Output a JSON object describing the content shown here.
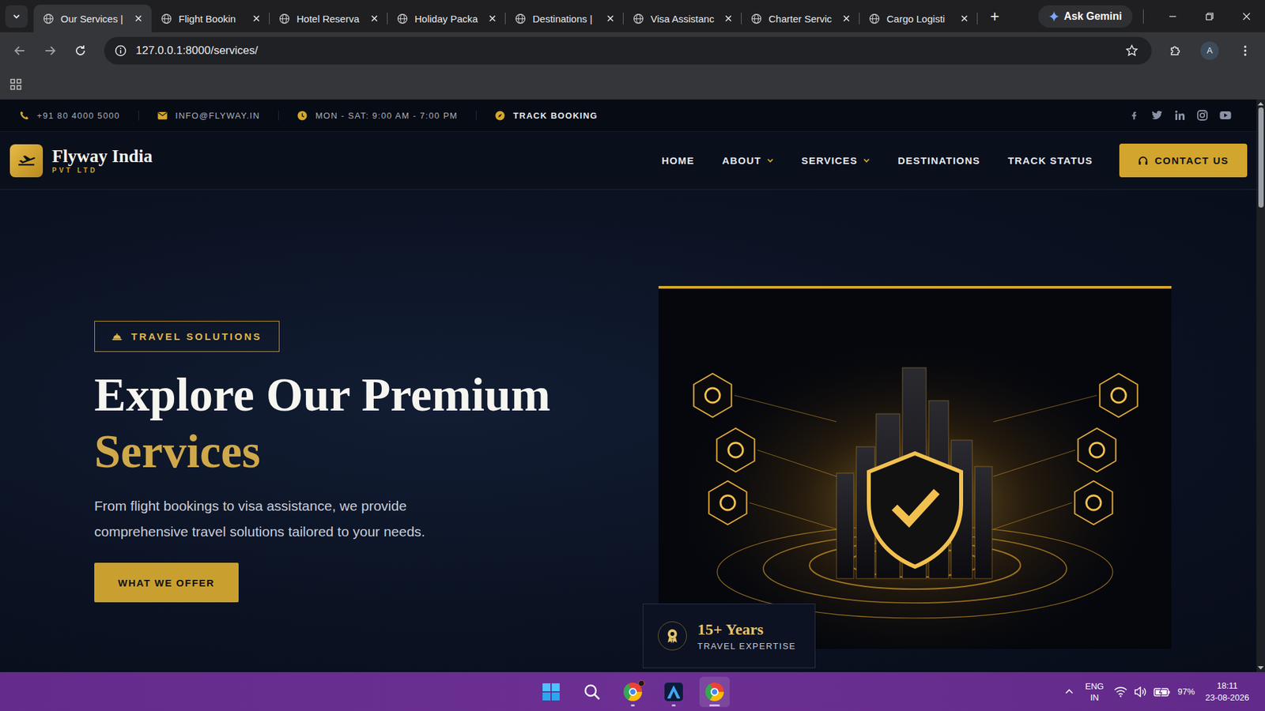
{
  "browser": {
    "tabs": [
      {
        "label": "Our Services |",
        "selected": true
      },
      {
        "label": "Flight Bookin",
        "selected": false
      },
      {
        "label": "Hotel Reserva",
        "selected": false
      },
      {
        "label": "Holiday Packa",
        "selected": false
      },
      {
        "label": "Destinations |",
        "selected": false
      },
      {
        "label": "Visa Assistanc",
        "selected": false
      },
      {
        "label": "Charter Servic",
        "selected": false
      },
      {
        "label": "Cargo Logisti",
        "selected": false
      }
    ],
    "new_tab": "+",
    "gemini": "Ask Gemini",
    "url": "127.0.0.1:8000/services/",
    "profile": "A"
  },
  "topbar": {
    "items": [
      {
        "kind": "phone",
        "label": "+91 80 4000 5000"
      },
      {
        "kind": "mail",
        "label": "INFO@FLYWAY.IN"
      },
      {
        "kind": "clock",
        "label": "MON - SAT: 9:00 AM - 7:00 PM"
      },
      {
        "kind": "track",
        "label": "TRACK BOOKING"
      }
    ],
    "socials": [
      {
        "kind": "facebook"
      },
      {
        "kind": "twitter"
      },
      {
        "kind": "linkedin"
      },
      {
        "kind": "instagram"
      },
      {
        "kind": "youtube"
      }
    ]
  },
  "navbar": {
    "brand": "Flyway India",
    "tagline": "PVT LTD",
    "items": [
      {
        "label": "HOME",
        "dropdown": false
      },
      {
        "label": "ABOUT",
        "dropdown": true
      },
      {
        "label": "SERVICES",
        "dropdown": true
      },
      {
        "label": "DESTINATIONS",
        "dropdown": false
      },
      {
        "label": "TRACK STATUS",
        "dropdown": false
      }
    ],
    "cta": "CONTACT US"
  },
  "hero": {
    "badge": "TRAVEL SOLUTIONS",
    "title": "Explore Our Premium",
    "highlight": "Services",
    "text": "From flight bookings to visa assistance, we provide comprehensive travel solutions tailored to your needs.",
    "button": "WHAT WE OFFER",
    "stat": {
      "value": "15+ Years",
      "label": "TRAVEL EXPERTISE"
    }
  },
  "scrollbar": {
    "level": 0.18
  },
  "taskbar": {
    "apps": [
      {
        "kind": "start",
        "running": false,
        "active": false,
        "notification": false
      },
      {
        "kind": "search",
        "running": false,
        "active": false,
        "notification": false
      },
      {
        "kind": "chrome",
        "running": true,
        "active": false,
        "notification": true
      },
      {
        "kind": "editor",
        "running": true,
        "active": false,
        "notification": false
      },
      {
        "kind": "chrome",
        "running": true,
        "active": true,
        "notification": false
      }
    ],
    "language": "ENG",
    "region": "IN",
    "battery": "97%",
    "time": "18:11",
    "date": "23-08-2026"
  }
}
